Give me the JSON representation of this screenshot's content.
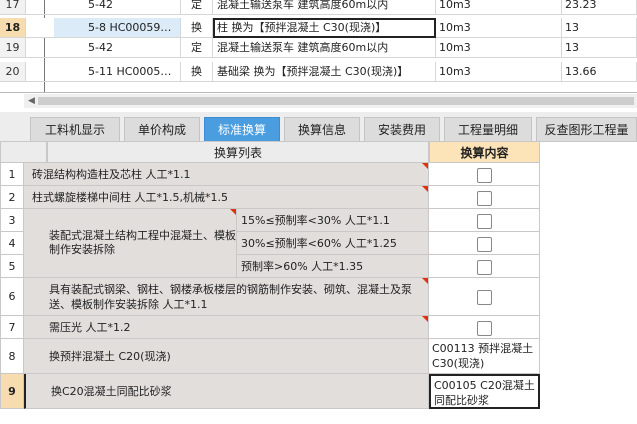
{
  "top_rows": [
    {
      "num": "17",
      "code": "5-42",
      "type": "定",
      "name": "混凝土输送泵车 建筑高度60m以内",
      "unit": "10m3",
      "qty": "23.23"
    },
    {
      "num": "18",
      "code": "5-8 HC00059…",
      "type": "换",
      "name": "柱  换为【预拌混凝土 C30(现浇)】",
      "unit": "10m3",
      "qty": "13"
    },
    {
      "num": "19",
      "code": "5-42",
      "type": "定",
      "name": "混凝土输送泵车 建筑高度60m以内",
      "unit": "10m3",
      "qty": "13"
    },
    {
      "num": "20",
      "code": "5-11 HC0005…",
      "type": "换",
      "name": "基础梁  换为【预拌混凝土 C30(现浇)】",
      "unit": "10m3",
      "qty": "13.66"
    }
  ],
  "tabs": [
    "工料机显示",
    "单价构成",
    "标准换算",
    "换算信息",
    "安装费用",
    "工程量明细",
    "反查图形工程量"
  ],
  "active_tab": "标准换算",
  "grid": {
    "header_list": "换算列表",
    "header_content": "换算内容",
    "rows": [
      {
        "num": "1",
        "text": "砖混结构构造柱及芯柱 人工*1.1",
        "checkbox": true,
        "mark": true
      },
      {
        "num": "2",
        "text": "柱式螺旋楼梯中间柱 人工*1.5,机械*1.5",
        "checkbox": true,
        "mark": true
      },
      {
        "num": "3",
        "text": "15%≤预制率<30% 人工*1.1",
        "checkbox": true,
        "mark": false
      },
      {
        "num": "4",
        "text": "30%≤预制率<60% 人工*1.25",
        "checkbox": true,
        "mark": false
      },
      {
        "num": "5",
        "text": "预制率>60% 人工*1.35",
        "checkbox": true,
        "mark": false
      },
      {
        "num": "6",
        "text": "具有装配式钢梁、钢柱、钢楼承板楼层的钢筋制作安装、砌筑、混凝土及泵送、模板制作安装拆除 人工*1.1",
        "checkbox": true,
        "mark": true
      },
      {
        "num": "7",
        "text": "需压光 人工*1.2",
        "checkbox": true,
        "mark": true
      },
      {
        "num": "8",
        "text": "换预拌混凝土 C20(现浇)",
        "content": "C00113  预拌混凝土 C30(现浇)"
      },
      {
        "num": "9",
        "text": "换C20混凝土同配比砂浆",
        "content": "C00105  C20混凝土同配比砂浆"
      }
    ],
    "group_label": "装配式混凝土结构工程中混凝土、模板制作安装拆除"
  }
}
